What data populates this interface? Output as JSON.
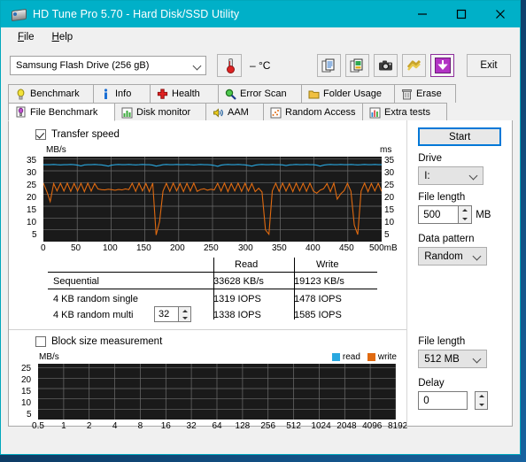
{
  "window": {
    "title": "HD Tune Pro 5.70 - Hard Disk/SSD Utility",
    "icon": "harddisk-icon",
    "minimize": "minimize-icon",
    "maximize": "maximize-icon",
    "close": "close-icon",
    "titlebar_color": "#00b0c8"
  },
  "menu": {
    "items": [
      "File",
      "Help"
    ]
  },
  "toolbar": {
    "drive_selected": "Samsung Flash Drive (256 gB)",
    "temperature": "– °C",
    "thermometer_icon": "thermometer-icon",
    "buttons": [
      {
        "name": "copy-text-icon"
      },
      {
        "name": "copy-image-icon"
      },
      {
        "name": "screenshot-camera-icon"
      },
      {
        "name": "options-icon"
      },
      {
        "name": "download-arrow-icon"
      }
    ],
    "exit_label": "Exit"
  },
  "tabs": {
    "row1": [
      {
        "label": "Benchmark",
        "icon": "bulb-icon",
        "active": false
      },
      {
        "label": "Info",
        "icon": "info-icon",
        "active": false
      },
      {
        "label": "Health",
        "icon": "health-cross-icon",
        "active": false
      },
      {
        "label": "Error Scan",
        "icon": "magnifier-icon",
        "active": false
      },
      {
        "label": "Folder Usage",
        "icon": "folder-icon",
        "active": false
      },
      {
        "label": "Erase",
        "icon": "trash-icon",
        "active": false
      }
    ],
    "row2": [
      {
        "label": "File Benchmark",
        "icon": "file-benchmark-icon",
        "active": true
      },
      {
        "label": "Disk monitor",
        "icon": "bar-chart-icon",
        "active": false
      },
      {
        "label": "AAM",
        "icon": "speaker-icon",
        "active": false
      },
      {
        "label": "Random Access",
        "icon": "scatter-icon",
        "active": false
      },
      {
        "label": "Extra tests",
        "icon": "extra-chart-icon",
        "active": false
      }
    ]
  },
  "transfer_section": {
    "checkbox_label": "Transfer speed",
    "checked": true
  },
  "results": {
    "columns": [
      "",
      "Read",
      "Write"
    ],
    "rows": [
      {
        "label": "Sequential",
        "read": "33628 KB/s",
        "write": "19123 KB/s"
      },
      {
        "label": "4 KB random single",
        "read": "1319 IOPS",
        "write": "1478 IOPS"
      },
      {
        "label": "4 KB random multi",
        "read": "1338 IOPS",
        "write": "1585 IOPS",
        "queue_depth": "32"
      }
    ]
  },
  "block_section": {
    "checkbox_label": "Block size measurement",
    "checked": false,
    "legend": [
      {
        "label": "read",
        "color": "#29a8e0"
      },
      {
        "label": "write",
        "color": "#e06a10"
      }
    ]
  },
  "right_panel_top": {
    "start_label": "Start",
    "drive_label": "Drive",
    "drive_value": "I:",
    "file_length_label": "File length",
    "file_length_value": "500",
    "file_length_unit": "MB",
    "data_pattern_label": "Data pattern",
    "data_pattern_value": "Random"
  },
  "right_panel_bottom": {
    "file_length_label": "File length",
    "file_length_value": "512 MB",
    "delay_label": "Delay",
    "delay_value": "0"
  },
  "chart_data": [
    {
      "type": "line",
      "title": "Transfer speed",
      "ylabel": "MB/s",
      "y2label": "ms",
      "xlabel": "",
      "x_ticks": [
        "0",
        "50",
        "100",
        "150",
        "200",
        "250",
        "300",
        "350",
        "400",
        "450",
        "500mB"
      ],
      "y_ticks": [
        "5",
        "10",
        "15",
        "20",
        "25",
        "30",
        "35"
      ],
      "y2_ticks": [
        "5",
        "10",
        "15",
        "20",
        "25",
        "30",
        "35"
      ],
      "ylim": [
        0,
        36
      ],
      "xlim": [
        0,
        500
      ],
      "grid": true,
      "background": "#1a1a1a",
      "series": [
        {
          "name": "read",
          "color": "#29a8e0",
          "values": [
            32.6,
            32.6,
            32.6,
            32.7,
            32.6,
            32.5,
            32.6,
            32.6,
            32.7,
            32.6,
            32.4,
            32.1,
            32.5,
            32.6,
            32.6,
            32.7,
            32.6,
            32.5,
            32.3,
            32.0,
            32.4,
            32.6,
            32.7,
            32.6,
            32.6,
            32.7,
            32.6,
            32.5,
            32.6,
            32.7,
            32.6,
            32.6,
            32.4,
            32.0,
            32.3,
            32.6,
            32.7,
            32.6,
            32.6,
            32.7,
            32.6,
            32.6,
            32.7,
            32.6,
            32.5,
            32.6,
            32.7,
            32.6,
            32.6,
            32.5,
            32.3,
            31.9,
            32.4,
            32.6,
            32.7,
            32.6,
            32.6,
            32.7,
            32.6,
            32.5,
            32.3,
            32.0,
            32.4,
            32.6,
            32.7,
            32.6,
            32.6,
            32.7,
            32.6,
            32.6,
            32.5,
            32.2,
            32.5,
            32.6,
            32.7,
            32.6,
            32.6,
            32.7,
            32.6,
            32.6,
            32.4,
            32.0,
            32.4,
            32.6,
            32.7,
            32.6,
            32.6,
            32.7,
            32.6,
            32.6,
            32.7,
            32.6,
            32.5,
            32.6,
            32.7,
            32.6,
            32.6,
            32.7,
            32.6,
            32.6
          ]
        },
        {
          "name": "write",
          "color": "#e06a10",
          "values": [
            24.8,
            21.2,
            17.0,
            24.6,
            21.5,
            24.7,
            21.4,
            24.8,
            21.3,
            24.6,
            21.5,
            24.7,
            21.2,
            24.8,
            21.4,
            24.6,
            22.3,
            22.0,
            21.9,
            22.2,
            22.0,
            21.8,
            22.1,
            21.9,
            22.3,
            22.0,
            24.7,
            21.3,
            24.8,
            21.5,
            24.6,
            21.2,
            24.8,
            2.8,
            8.5,
            21.4,
            24.7,
            21.3,
            24.8,
            21.5,
            24.6,
            21.2,
            24.7,
            21.4,
            24.8,
            21.3,
            22.1,
            22.4,
            21.8,
            22.2,
            21.9,
            24.7,
            21.4,
            24.8,
            21.2,
            24.6,
            21.5,
            24.8,
            21.3,
            24.7,
            21.4,
            24.6,
            21.2,
            22.6,
            21.0,
            5.0,
            3.1,
            21.5,
            24.7,
            21.3,
            24.8,
            21.4,
            24.6,
            21.2,
            24.8,
            21.5,
            24.7,
            21.3,
            24.8,
            21.4,
            20.5,
            21.8,
            22.4,
            24.6,
            21.2,
            24.8,
            18.0,
            20.2,
            21.6,
            24.7,
            21.3,
            7.0,
            3.0,
            21.4,
            24.8,
            21.2,
            24.6,
            21.5,
            24.7,
            21.3
          ]
        }
      ]
    },
    {
      "type": "line",
      "title": "Block size measurement",
      "ylabel": "MB/s",
      "x_ticks": [
        "0.5",
        "1",
        "2",
        "4",
        "8",
        "16",
        "32",
        "64",
        "128",
        "256",
        "512",
        "1024",
        "2048",
        "4096",
        "8192"
      ],
      "y_ticks": [
        "5",
        "10",
        "15",
        "20",
        "25"
      ],
      "ylim": [
        0,
        27
      ],
      "grid": true,
      "background": "#1a1a1a",
      "series": [
        {
          "name": "read",
          "color": "#29a8e0",
          "values": []
        },
        {
          "name": "write",
          "color": "#e06a10",
          "values": []
        }
      ]
    }
  ]
}
